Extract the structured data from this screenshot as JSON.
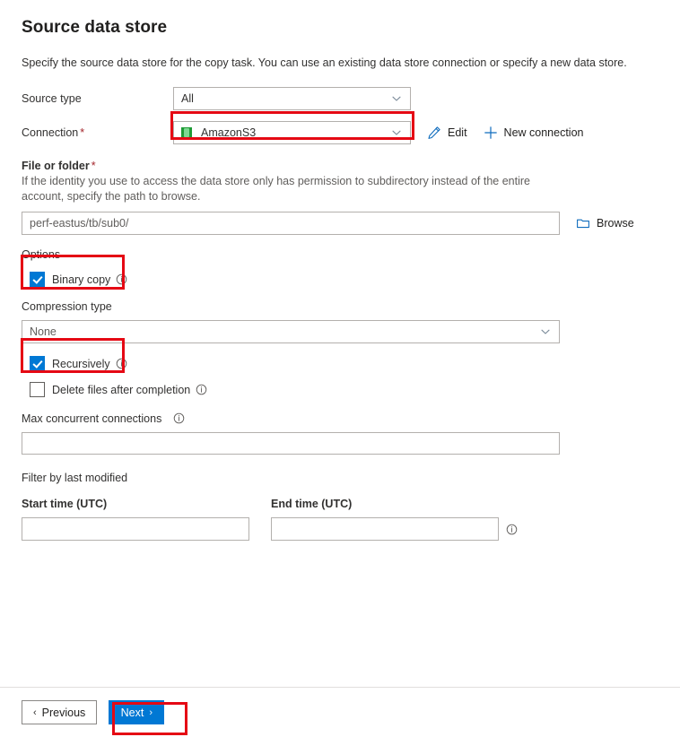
{
  "page": {
    "title": "Source data store",
    "description": "Specify the source data store for the copy task. You can use an existing data store connection or specify a new data store."
  },
  "source_type": {
    "label": "Source type",
    "value": "All"
  },
  "connection": {
    "label": "Connection",
    "required_mark": "*",
    "value": "AmazonS3",
    "icon": "amazon-s3-icon",
    "edit_label": "Edit",
    "new_connection_label": "New connection"
  },
  "file_or_folder": {
    "label": "File or folder",
    "required_mark": "*",
    "helper": "If the identity you use to access the data store only has permission to subdirectory instead of the entire account, specify the path to browse.",
    "value": "perf-eastus/tb/sub0/",
    "browse_label": "Browse"
  },
  "options": {
    "label": "Options",
    "binary_copy": {
      "label": "Binary copy",
      "checked": true
    },
    "compression_type": {
      "label": "Compression type",
      "value": "None"
    },
    "recursively": {
      "label": "Recursively",
      "checked": true
    },
    "delete_files_after_completion": {
      "label": "Delete files after completion",
      "checked": false
    },
    "max_concurrent_connections": {
      "label": "Max concurrent connections",
      "value": ""
    }
  },
  "filter_by_last_modified": {
    "label": "Filter by last modified",
    "start_time": {
      "label": "Start time (UTC)",
      "value": ""
    },
    "end_time": {
      "label": "End time (UTC)",
      "value": ""
    }
  },
  "footer": {
    "previous_label": "Previous",
    "previous_arrow": "‹",
    "next_label": "Next",
    "next_arrow": "›"
  },
  "colors": {
    "accent": "#0078d4",
    "link": "#0f6cbd",
    "highlight": "#e50914",
    "required": "#a4262c",
    "s3_green": "#1f9b36"
  }
}
